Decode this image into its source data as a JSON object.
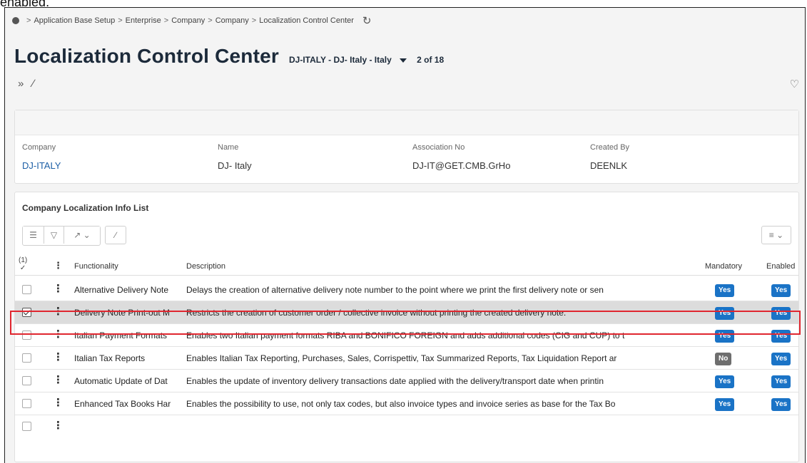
{
  "top_text": "enabled.",
  "breadcrumb": {
    "items": [
      "Application Base Setup",
      "Enterprise",
      "Company",
      "Company",
      "Localization Control Center"
    ]
  },
  "header": {
    "title": "Localization Control Center",
    "record_selector": "DJ-ITALY - DJ- Italy - Italy",
    "record_count": "2 of 18"
  },
  "company_card": {
    "fields": [
      {
        "label": "Company",
        "value": "DJ-ITALY"
      },
      {
        "label": "Name",
        "value": "DJ- Italy"
      },
      {
        "label": "Association No",
        "value": "DJ-IT@GET.CMB.GrHo"
      },
      {
        "label": "Created By",
        "value": "DEENLK"
      }
    ]
  },
  "list": {
    "title": "Company Localization Info List",
    "selected_count": "(1)",
    "columns": {
      "functionality": "Functionality",
      "description": "Description",
      "mandatory": "Mandatory",
      "enabled": "Enabled"
    },
    "rows": [
      {
        "functionality": "Alternative Delivery Note",
        "description": "Delays the creation of alternative delivery note number to the point where we print the first delivery note or sen",
        "mandatory": "Yes",
        "enabled": "Yes",
        "checked": false
      },
      {
        "functionality": "Delivery Note Print-out M",
        "description": "Restricts the creation of customer order / collective invoice without printing the created delivery note.",
        "mandatory": "Yes",
        "enabled": "Yes",
        "checked": true
      },
      {
        "functionality": "Italian Payment Formats",
        "description": "Enables two Italian payment formats RIBA and BONIFICO FOREIGN and adds additional codes (CIG and CUP) to t",
        "mandatory": "Yes",
        "enabled": "Yes",
        "checked": false
      },
      {
        "functionality": "Italian Tax Reports",
        "description": "Enables Italian Tax Reporting, Purchases, Sales, Corrispettiv, Tax Summarized Reports, Tax Liquidation Report ar",
        "mandatory": "No",
        "enabled": "Yes",
        "checked": false
      },
      {
        "functionality": "Automatic Update of Dat",
        "description": "Enables the update of inventory delivery transactions date applied with the delivery/transport date when printin",
        "mandatory": "Yes",
        "enabled": "Yes",
        "checked": false
      },
      {
        "functionality": "Enhanced Tax Books Har",
        "description": "Enables the possibility to use, not only tax codes, but also invoice types and invoice series as base for the Tax Bo",
        "mandatory": "Yes",
        "enabled": "Yes",
        "checked": false
      }
    ]
  },
  "colors": {
    "accent": "#1a73c6",
    "highlight": "#e0262f",
    "link": "#1d5fa6"
  }
}
